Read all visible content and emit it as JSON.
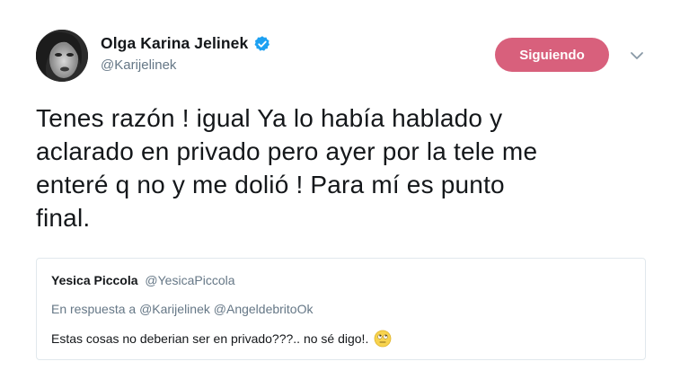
{
  "author": {
    "display_name": "Olga Karina Jelinek",
    "handle": "@Karijelinek",
    "verified": true
  },
  "follow_button": {
    "label": "Siguiendo",
    "color": "#d8607c"
  },
  "tweet": {
    "lines": [
      "Tenes razón ! igual Ya lo había hablado y",
      "aclarado en privado pero ayer por la tele me",
      "enteré q no y me dolió ! Para mí es punto",
      "final."
    ]
  },
  "quoted_tweet": {
    "display_name": "Yesica Piccola",
    "handle": "@YesicaPiccola",
    "reply_prefix": "En respuesta a",
    "reply_to": [
      "@Karijelinek",
      "@AngeldebritoOk"
    ],
    "text": "Estas cosas no deberian ser en privado???.. no sé  digo!.",
    "emoji": "rolling-eyes-face-icon"
  },
  "colors": {
    "text": "#14171a",
    "secondary": "#657786",
    "verified_blue": "#1da1f2",
    "border": "#e1e8ed"
  }
}
